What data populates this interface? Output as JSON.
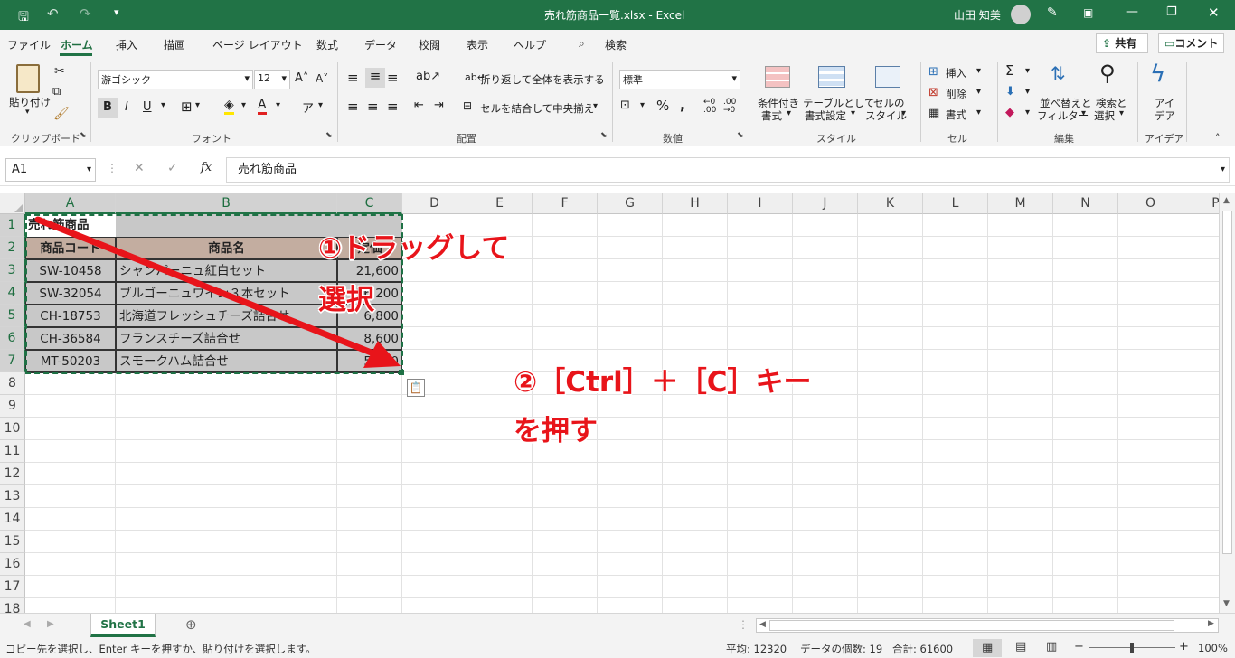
{
  "titlebar": {
    "title": "売れ筋商品一覧.xlsx  -  Excel",
    "user": "山田 知美"
  },
  "menu": [
    "ファイル",
    "ホーム",
    "挿入",
    "描画",
    "ページ レイアウト",
    "数式",
    "データ",
    "校閲",
    "表示",
    "ヘルプ"
  ],
  "search_label": "検索",
  "share_label": "共有",
  "comment_label": "コメント",
  "ribbon": {
    "paste": "貼り付け",
    "clipboard": "クリップボード",
    "font_name": "游ゴシック",
    "font_size": "12",
    "font_group": "フォント",
    "wrap_text": "折り返して全体を表示する",
    "merge_center": "セルを結合して中央揃え",
    "alignment": "配置",
    "number_format": "標準",
    "number": "数値",
    "cond_format_1": "条件付き",
    "cond_format_2": "書式",
    "table_format_1": "テーブルとして",
    "table_format_2": "書式設定",
    "cell_style_1": "セルの",
    "cell_style_2": "スタイル",
    "styles": "スタイル",
    "insert": "挿入",
    "delete": "削除",
    "format": "書式",
    "cells": "セル",
    "sort_1": "並べ替えと",
    "sort_2": "フィルター",
    "find_1": "検索と",
    "find_2": "選択",
    "editing": "編集",
    "ideas_1": "アイ",
    "ideas_2": "デア",
    "ideas": "アイデア"
  },
  "formula_bar": {
    "name_box": "A1",
    "content": "売れ筋商品"
  },
  "columns": [
    "A",
    "B",
    "C",
    "D",
    "E",
    "F",
    "G",
    "H",
    "I",
    "J",
    "K",
    "L",
    "M",
    "N",
    "O",
    "P"
  ],
  "rows": [
    "1",
    "2",
    "3",
    "4",
    "5",
    "6",
    "7",
    "8",
    "9",
    "10",
    "11",
    "12",
    "13",
    "14",
    "15",
    "16",
    "17",
    "18"
  ],
  "sheet": {
    "a1": "売れ筋商品",
    "headers": [
      "商品コード",
      "商品名",
      "定価"
    ],
    "data": [
      {
        "code": "SW-10458",
        "name": "シャンパーニュ紅白セット",
        "price": "21,600"
      },
      {
        "code": "SW-32054",
        "name": "ブルゴーニュワイン３本セット",
        "price": "16,200"
      },
      {
        "code": "CH-18753",
        "name": "北海道フレッシュチーズ詰合せ",
        "price": "6,800"
      },
      {
        "code": "CH-36584",
        "name": "フランスチーズ詰合せ",
        "price": "8,600"
      },
      {
        "code": "MT-50203",
        "name": "スモークハム詰合せ",
        "price": "5,800"
      }
    ]
  },
  "annotations": {
    "step1_line1": "①ドラッグして",
    "step1_line2": "選択",
    "step2_line1": "②［Ctrl］＋［C］キー",
    "step2_line2": "を押す"
  },
  "sheet_tab": "Sheet1",
  "status": {
    "message": "コピー先を選択し、Enter キーを押すか、貼り付けを選択します。",
    "average": "平均: 12320",
    "count": "データの個数: 19",
    "sum": "合計: 61600",
    "zoom": "100%"
  },
  "colors": {
    "accent": "#217346",
    "annotation": "#e8141a",
    "header_fill": "#c3ada0",
    "selection": "#c6c6c6"
  }
}
